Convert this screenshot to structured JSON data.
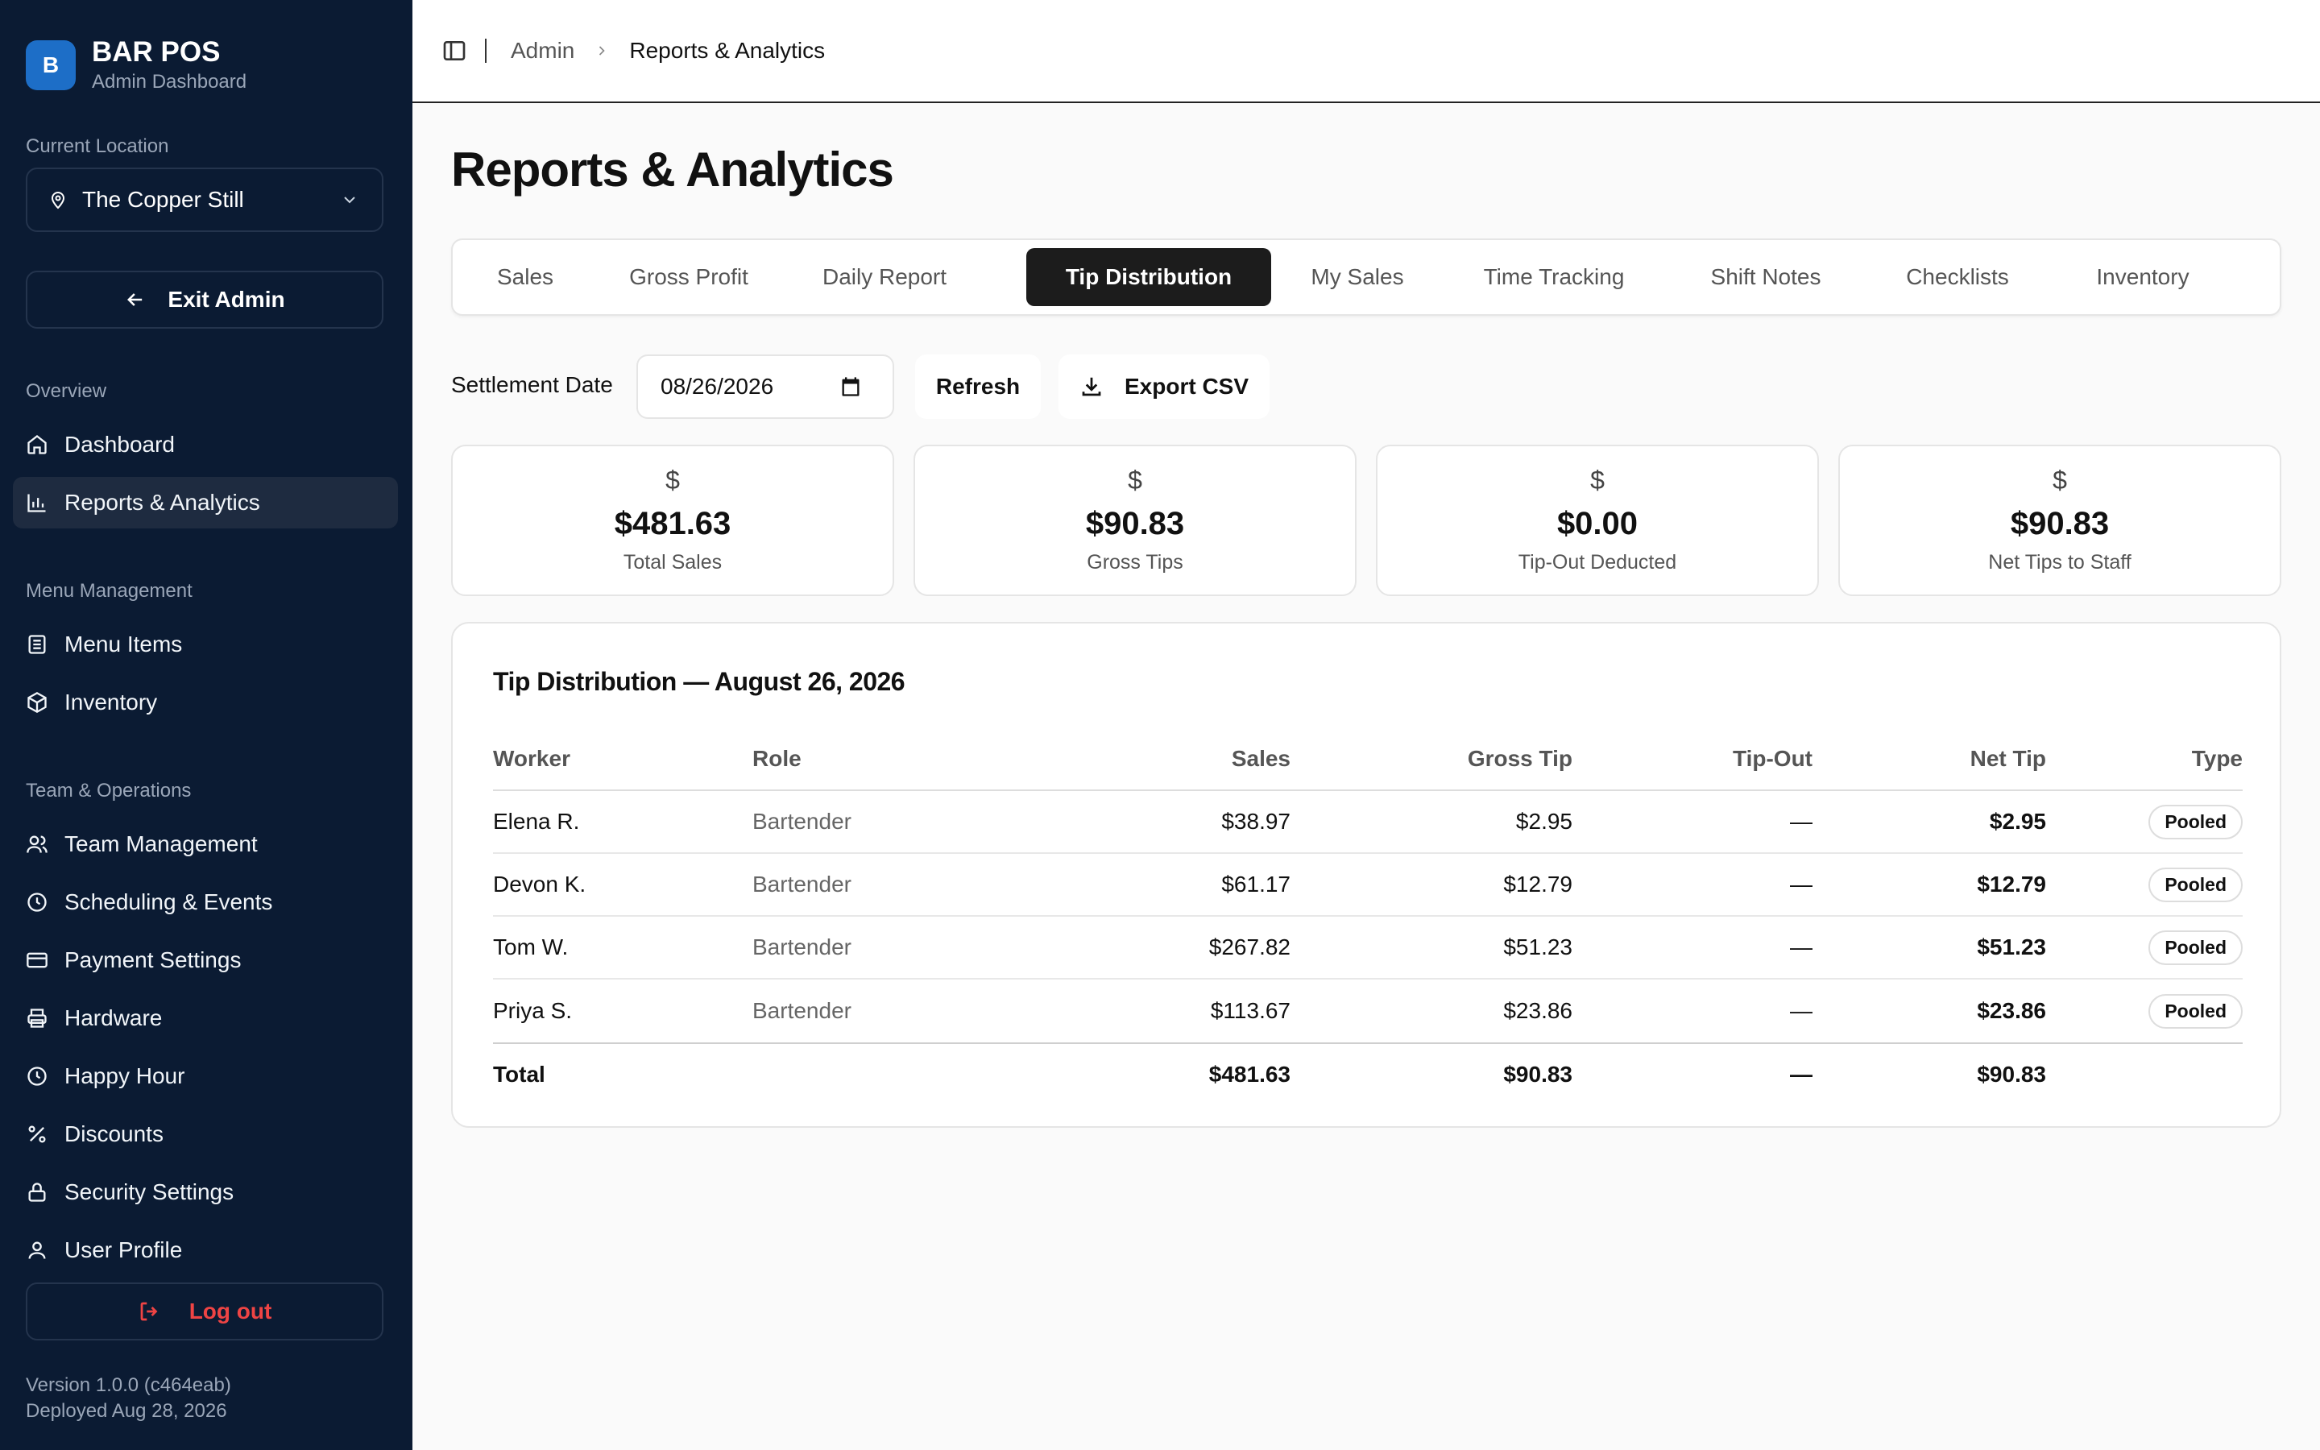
{
  "app": {
    "badge": "B",
    "title": "BAR POS",
    "subtitle": "Admin Dashboard"
  },
  "sidebar": {
    "location_label": "Current Location",
    "location_value": "The Copper Still",
    "exit_label": "Exit Admin",
    "sections": {
      "overview": "Overview",
      "menu_management": "Menu Management",
      "team_operations": "Team & Operations"
    },
    "items": {
      "dashboard": "Dashboard",
      "reports": "Reports & Analytics",
      "menu_items": "Menu Items",
      "inventory": "Inventory",
      "team_management": "Team Management",
      "scheduling": "Scheduling & Events",
      "payment_settings": "Payment Settings",
      "hardware": "Hardware",
      "happy_hour": "Happy Hour",
      "discounts": "Discounts",
      "security_settings": "Security Settings",
      "user_profile": "User Profile"
    },
    "logout_label": "Log out",
    "version": "Version 1.0.0 (c464eab)",
    "deployed": "Deployed Aug 28, 2026"
  },
  "header": {
    "breadcrumb_root": "Admin",
    "breadcrumb_current": "Reports & Analytics"
  },
  "main": {
    "title": "Reports & Analytics",
    "tabs": [
      "Sales",
      "Gross Profit",
      "Daily Report",
      "Tip Distribution",
      "My Sales",
      "Time Tracking",
      "Shift Notes",
      "Checklists",
      "Inventory"
    ],
    "active_tab": "Tip Distribution",
    "settlement_label": "Settlement Date",
    "settlement_date": "08/26/2026",
    "refresh_label": "Refresh",
    "export_label": "Export CSV"
  },
  "stats": [
    {
      "symbol": "$",
      "value": "$481.63",
      "label": "Total Sales"
    },
    {
      "symbol": "$",
      "value": "$90.83",
      "label": "Gross Tips"
    },
    {
      "symbol": "$",
      "value": "$0.00",
      "label": "Tip-Out Deducted"
    },
    {
      "symbol": "$",
      "value": "$90.83",
      "label": "Net Tips to Staff"
    }
  ],
  "table": {
    "title": "Tip Distribution — August 26, 2026",
    "headers": {
      "worker": "Worker",
      "role": "Role",
      "sales": "Sales",
      "gross": "Gross Tip",
      "tipout": "Tip-Out",
      "net": "Net Tip",
      "type": "Type"
    },
    "rows": [
      {
        "worker": "Elena R.",
        "role": "Bartender",
        "sales": "$38.97",
        "gross": "$2.95",
        "tipout": "—",
        "net": "$2.95",
        "type": "Pooled"
      },
      {
        "worker": "Devon K.",
        "role": "Bartender",
        "sales": "$61.17",
        "gross": "$12.79",
        "tipout": "—",
        "net": "$12.79",
        "type": "Pooled"
      },
      {
        "worker": "Tom W.",
        "role": "Bartender",
        "sales": "$267.82",
        "gross": "$51.23",
        "tipout": "—",
        "net": "$51.23",
        "type": "Pooled"
      },
      {
        "worker": "Priya S.",
        "role": "Bartender",
        "sales": "$113.67",
        "gross": "$23.86",
        "tipout": "—",
        "net": "$23.86",
        "type": "Pooled"
      }
    ],
    "total": {
      "label": "Total",
      "sales": "$481.63",
      "gross": "$90.83",
      "tipout": "—",
      "net": "$90.83"
    }
  }
}
